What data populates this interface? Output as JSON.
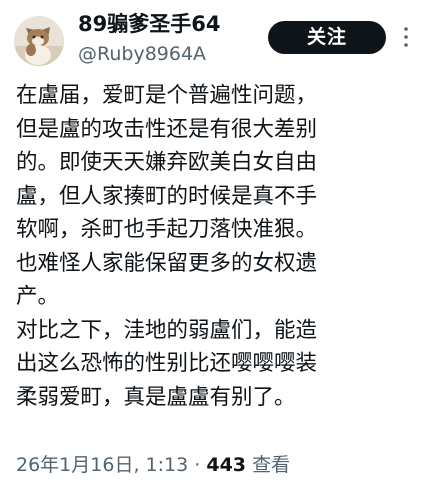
{
  "author": {
    "display_name": "89骟爹圣手64",
    "handle": "@Ruby8964A",
    "avatar_icon": "cat-avatar"
  },
  "header": {
    "follow_label": "关注",
    "more_icon": "more-vertical-icon"
  },
  "tweet": {
    "lines": [
      "在盧届，爱町是个普遍性问题，",
      "但是盧的攻击性还是有很大差别",
      "的。即使天天嫌弃欧美白女自由",
      "盧，但人家揍町的时候是真不手",
      "软啊，杀町也手起刀落快准狠。",
      "也难怪人家能保留更多的女权遗",
      "产。",
      "对比之下，洼地的弱盧们，能造",
      "出这么恐怖的性别比还嘤嘤嘤装",
      "柔弱爱町，真是盧盧有别了。"
    ]
  },
  "meta": {
    "timestamp": "26年1月16日, 1:13",
    "separator": "·",
    "views_count": "443",
    "views_label": "查看"
  },
  "colors": {
    "text": "#0f1419",
    "secondary": "#536471",
    "button_bg": "#0f1419",
    "button_text": "#ffffff"
  }
}
